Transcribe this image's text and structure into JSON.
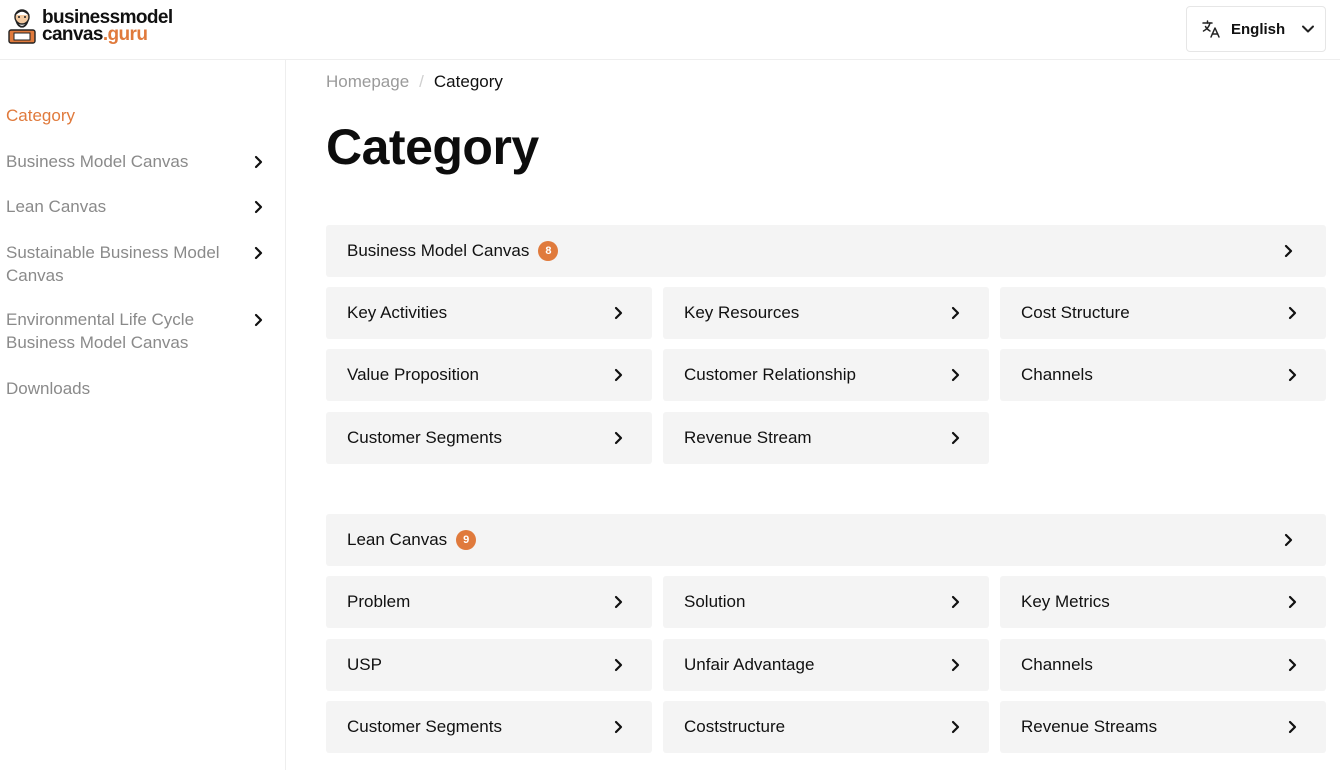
{
  "header": {
    "logo": {
      "line1": "businessmodel",
      "line2_a": "canvas",
      "line2_b": ".guru"
    },
    "language": {
      "label": "English"
    }
  },
  "sidebar": {
    "items": [
      {
        "label": "Category",
        "active": true,
        "has_chevron": false
      },
      {
        "label": "Business Model Canvas",
        "has_chevron": true
      },
      {
        "label": "Lean Canvas",
        "has_chevron": true
      },
      {
        "label": "Sustainable Business Model Canvas",
        "has_chevron": true
      },
      {
        "label": "Environmental Life Cycle Business Model Canvas",
        "has_chevron": true
      },
      {
        "label": "Downloads",
        "has_chevron": false
      }
    ]
  },
  "breadcrumb": {
    "home": "Homepage",
    "separator": "/",
    "current": "Category"
  },
  "page": {
    "title": "Category"
  },
  "groups": [
    {
      "label": "Business Model Canvas",
      "count": "8",
      "items": [
        "Key Activities",
        "Key Resources",
        "Cost Structure",
        "Value Proposition",
        "Customer Relationship",
        "Channels",
        "Customer Segments",
        "Revenue Stream"
      ]
    },
    {
      "label": "Lean Canvas",
      "count": "9",
      "items": [
        "Problem",
        "Solution",
        "Key Metrics",
        "USP",
        "Unfair Advantage",
        "Channels",
        "Customer Segments",
        "Coststructure",
        "Revenue Streams"
      ]
    }
  ],
  "colors": {
    "accent": "#e07a3c",
    "card_bg": "#f4f4f4",
    "muted_text": "#8a8a8a"
  }
}
